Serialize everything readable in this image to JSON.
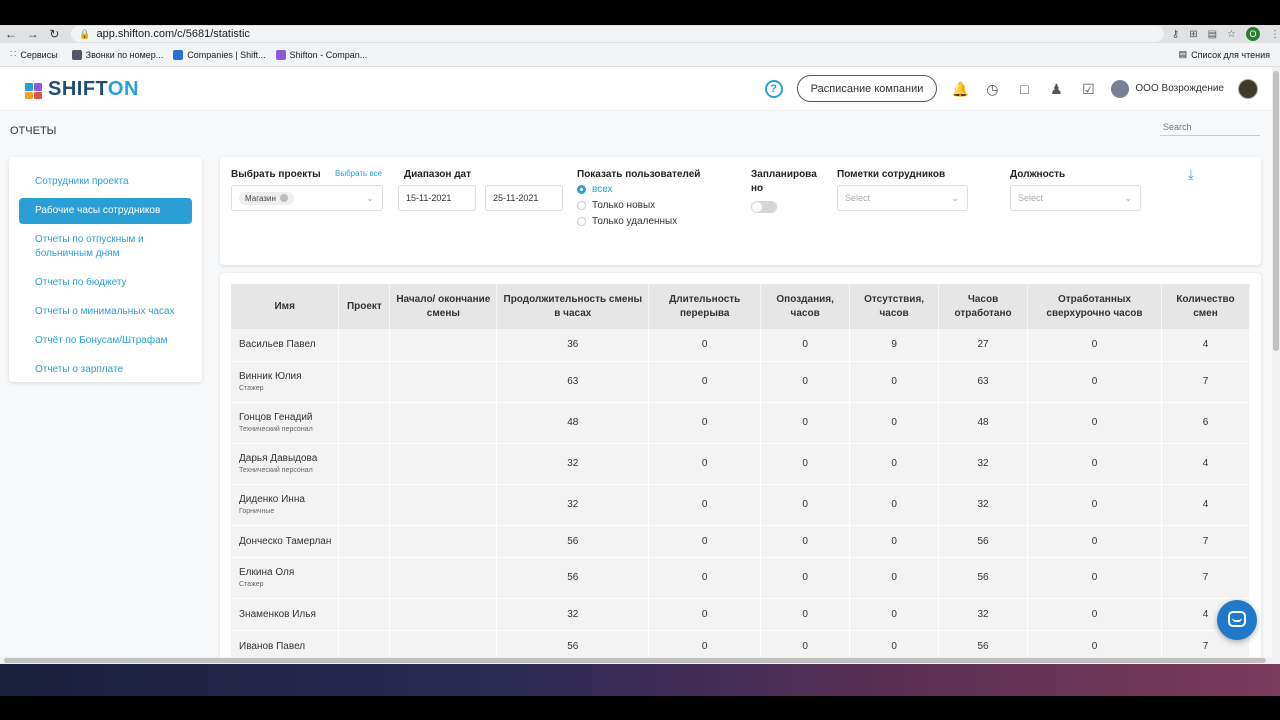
{
  "browser": {
    "url": "app.shifton.com/c/5681/statistic",
    "bookmarks": [
      "Сервисы",
      "Звонки по номер...",
      "Companies | Shift...",
      "Shifton - Compan..."
    ],
    "reading_list": "Список для чтения",
    "profile_letter": "O"
  },
  "header": {
    "logo_a": "SHIFT",
    "logo_b": "ON",
    "help": "?",
    "schedule_button": "Расписание компании",
    "company_name": "ООО Возрождение"
  },
  "page": {
    "title": "ОТЧЕТЫ",
    "search_placeholder": "Search"
  },
  "sidebar": {
    "items": [
      {
        "label": "Сотрудники проекта",
        "active": false
      },
      {
        "label": "Рабочие часы сотрудников",
        "active": true
      },
      {
        "label": "Отчеты по отпускным и больничным дням",
        "active": false
      },
      {
        "label": "Отчеты по бюджету",
        "active": false
      },
      {
        "label": "Отчеты о минимальных часах",
        "active": false
      },
      {
        "label": "Отчёт по Бонусам/Штрафам",
        "active": false
      },
      {
        "label": "Отчеты о зарплате",
        "active": false
      }
    ]
  },
  "filters": {
    "projects_label": "Выбрать проекты",
    "select_all": "Выбрать все",
    "project_chip": "Магазин",
    "date_range_label": "Диапазон дат",
    "date_from": "15-11-2021",
    "date_to": "25-11-2021",
    "show_users_label": "Показать пользователей",
    "show_options": [
      "всех",
      "Только новых",
      "Только удаленных"
    ],
    "scheduled_label_1": "Запланирова",
    "scheduled_label_2": "но",
    "scheduled_on": false,
    "marks_label": "Пометки сотрудников",
    "marks_placeholder": "Select",
    "position_label": "Должность",
    "position_placeholder": "Select"
  },
  "table": {
    "headers": [
      "Имя",
      "Проект",
      "Начало/ окончание смены",
      "Продолжительность смены в часах",
      "Длительность перерыва",
      "Опоздания, часов",
      "Отсутствия, часов",
      "Часов отработано",
      "Отработанных сверхурочно часов",
      "Количество смен"
    ],
    "rows": [
      {
        "name": "Васильев Павел",
        "role": "",
        "project": "",
        "shift": "",
        "duration": "36",
        "break": "0",
        "late": "0",
        "absent": "9",
        "worked": "27",
        "overtime": "0",
        "shifts": "4"
      },
      {
        "name": "Винник Юлия",
        "role": "Стажер",
        "project": "",
        "shift": "",
        "duration": "63",
        "break": "0",
        "late": "0",
        "absent": "0",
        "worked": "63",
        "overtime": "0",
        "shifts": "7"
      },
      {
        "name": "Гонцов Генадий",
        "role": "Технический персонал",
        "project": "",
        "shift": "",
        "duration": "48",
        "break": "0",
        "late": "0",
        "absent": "0",
        "worked": "48",
        "overtime": "0",
        "shifts": "6"
      },
      {
        "name": "Дарья Давыдова",
        "role": "Технический персонал",
        "project": "",
        "shift": "",
        "duration": "32",
        "break": "0",
        "late": "0",
        "absent": "0",
        "worked": "32",
        "overtime": "0",
        "shifts": "4"
      },
      {
        "name": "Диденко Инна",
        "role": "Горничные",
        "project": "",
        "shift": "",
        "duration": "32",
        "break": "0",
        "late": "0",
        "absent": "0",
        "worked": "32",
        "overtime": "0",
        "shifts": "4"
      },
      {
        "name": "Донческо Тамерлан",
        "role": "",
        "project": "",
        "shift": "",
        "duration": "56",
        "break": "0",
        "late": "0",
        "absent": "0",
        "worked": "56",
        "overtime": "0",
        "shifts": "7"
      },
      {
        "name": "Елкина Оля",
        "role": "Стажер",
        "project": "",
        "shift": "",
        "duration": "56",
        "break": "0",
        "late": "0",
        "absent": "0",
        "worked": "56",
        "overtime": "0",
        "shifts": "7"
      },
      {
        "name": "Знаменков Илья",
        "role": "",
        "project": "",
        "shift": "",
        "duration": "32",
        "break": "0",
        "late": "0",
        "absent": "0",
        "worked": "32",
        "overtime": "0",
        "shifts": "4"
      },
      {
        "name": "Иванов Павел",
        "role": "",
        "project": "",
        "shift": "",
        "duration": "56",
        "break": "0",
        "late": "0",
        "absent": "0",
        "worked": "56",
        "overtime": "0",
        "shifts": "7"
      }
    ]
  },
  "colors": {
    "accent": "#2a9fd6",
    "logo_dark": "#1f4d7a",
    "chat": "#1f78c8"
  }
}
